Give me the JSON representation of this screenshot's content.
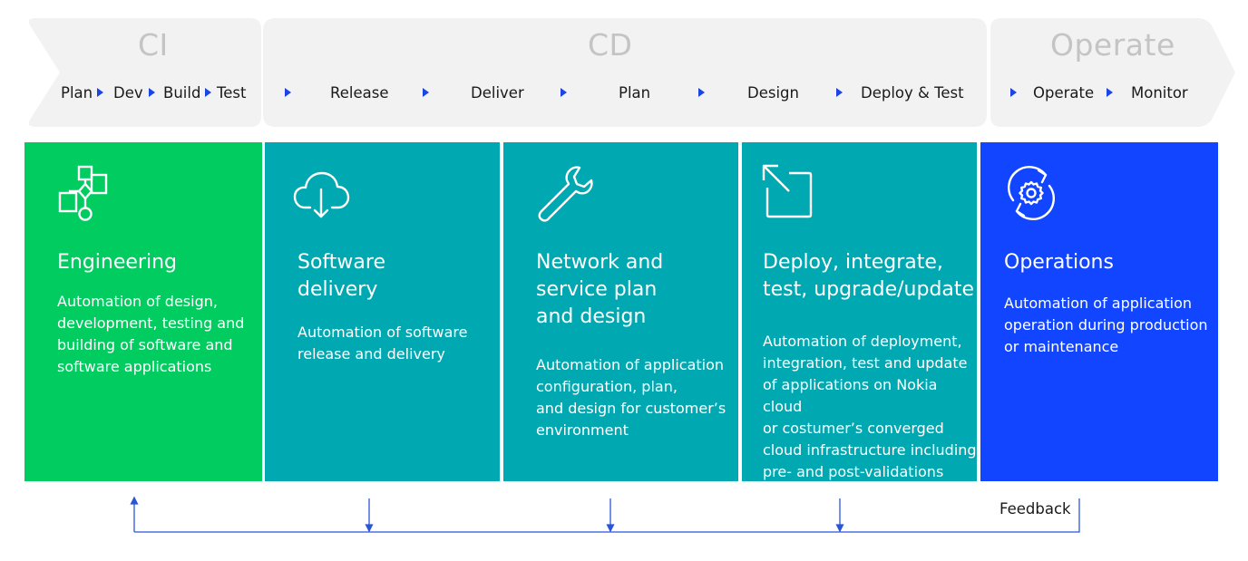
{
  "phases": {
    "ci": {
      "title": "CI",
      "steps": [
        "Plan",
        "Dev",
        "Build",
        "Test"
      ]
    },
    "cd": {
      "title": "CD",
      "steps": [
        "Release",
        "Deliver",
        "Plan",
        "Design",
        "Deploy & Test"
      ]
    },
    "operate": {
      "title": "Operate",
      "steps": [
        "Operate",
        "Monitor"
      ]
    }
  },
  "cards": [
    {
      "icon": "flowchart-icon",
      "color": "#00cc5f",
      "title": "Engineering",
      "description": "Automation of design,\ndevelopment, testing and\nbuilding of software and\nsoftware applications"
    },
    {
      "icon": "cloud-download-icon",
      "color": "#00a8b2",
      "title": "Software\ndelivery",
      "description": "Automation of software\nrelease and delivery"
    },
    {
      "icon": "wrench-icon",
      "color": "#00a8b2",
      "title": "Network and\nservice plan\nand design",
      "description": "Automation of application\nconfiguration, plan,\nand design for customer’s\nenvironment"
    },
    {
      "icon": "expand-arrow-icon",
      "color": "#00a8b2",
      "title": "Deploy, integrate,\ntest, upgrade/update",
      "description": "Automation of deployment,\nintegration, test and update\nof applications on Nokia cloud\nor costumer’s converged\ncloud infrastructure including\npre- and post-validations"
    },
    {
      "icon": "gear-cycle-icon",
      "color": "#1245ff",
      "title": "Operations",
      "description": "Automation of application\noperation during production\nor maintenance"
    }
  ],
  "feedback": {
    "label": "Feedback"
  },
  "colors": {
    "arrow_fill": "#f2f2f2",
    "accent": "#1a44e6",
    "phase_title": "#c4c4c4"
  }
}
